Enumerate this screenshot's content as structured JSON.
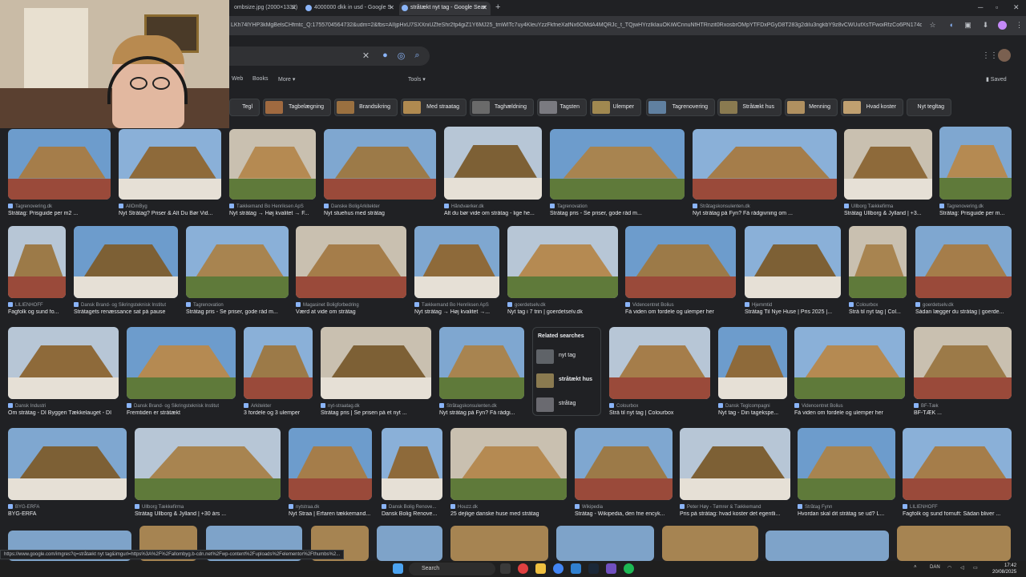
{
  "browser": {
    "tabs": [
      {
        "label": "ombsize.jpg (2000×1332)",
        "active": false
      },
      {
        "label": "4000000 dkk in usd - Google S",
        "active": false
      },
      {
        "label": "stråtækt nyt tag - Google Sear",
        "active": true
      }
    ],
    "url": "LKh74lYHP3kMgBelsCHfmtc_Q:1755704564732&udm=2&fbs=AIIjpHxU7SXXniUZfeShr2fp4giZ1Y6MJ25_tmWITc7uy4KleuYzzFkfneXafNx6OMdA4MQRJc_t_TQjwHYrzlkIauOKiWCnnuNfHTRnzit0RxosbrOMpYTFDxPGyD8T283g2diIu3ngkbY9z8vCWUufXsTFwoiRfzCo6PN174qxySRWv...",
    "status_url": "https://www.google.com/imgres?q=stråtækt nyt tag&imgurl=https%3A%2F%2Fallombyg.b-cdn.net%2Fwp-content%2Fuploads%2Felementor%2Fthumbs%2...",
    "new_tab_icon": "plus-icon",
    "profile_icon": "avatar-icon"
  },
  "google": {
    "nav": [
      "Web",
      "Books",
      "More",
      "Tools"
    ],
    "saved_label": "Saved",
    "chips": [
      {
        "label": "Tegl",
        "color": "#8b3a2a"
      },
      {
        "label": "Tagbelægning",
        "color": "#a06a40"
      },
      {
        "label": "Brandsikring",
        "color": "#9a7040"
      },
      {
        "label": "Med straatag",
        "color": "#b08a50"
      },
      {
        "label": "Taghældning",
        "color": "#6a6a6a"
      },
      {
        "label": "Tagsten",
        "color": "#7a7a80"
      },
      {
        "label": "Ulemper",
        "color": "#a08850"
      },
      {
        "label": "Tagrenovering",
        "color": "#6080a0"
      },
      {
        "label": "Stråtækt hus",
        "color": "#8a7a50"
      },
      {
        "label": "Menning",
        "color": "#b09060"
      },
      {
        "label": "Hvad koster",
        "color": "#c0a070"
      },
      {
        "label": "Nyt tegltag",
        "color": ""
      }
    ],
    "results": [
      {
        "src": "Tagrenovering.dk",
        "title": "Stråtag: Prisguide per m2 ..."
      },
      {
        "src": "AllOmByg",
        "title": "Nyt Stråtag? Priser & Alt Du Bør Vid..."
      },
      {
        "src": "Tækkemand Bo Henriksen ApS",
        "title": "Nyt stråtag → Høj kvalitet → F..."
      },
      {
        "src": "Danske BoligArkitekter",
        "title": "Nyt stuehus med stråtag"
      },
      {
        "src": "Håndværker.dk",
        "title": "Alt du bør vide om stråtag - lige he..."
      },
      {
        "src": "Tagrenovation",
        "title": "Stråtag pris - Se priser, gode råd m..."
      },
      {
        "src": "Stråtagskonsulenten.dk",
        "title": "Nyt stråtag på Fyn? Få rådgivning om ..."
      },
      {
        "src": "Ullborg Tækkefirma",
        "title": "Stråtag Ullborg & Jylland | +3..."
      },
      {
        "src": "Tagrenovering.dk",
        "title": "Stråtag: Prisguide per m..."
      },
      {
        "src": "LILIENHOFF",
        "title": "Fagfolk og sund fo..."
      },
      {
        "src": "Dansk Brand- og Sikringsteknisk Institut",
        "title": "Stråtagets renæssance sat på pause"
      },
      {
        "src": "Tagrenovation",
        "title": "Stråtag pris - Se priser, gode råd m..."
      },
      {
        "src": "Magasinet Boligforbedring",
        "title": "Værd at vide om stråtag"
      },
      {
        "src": "Tækkemand Bo Henriksen ApS",
        "title": "Nyt stråtag → Høj kvalitet →..."
      },
      {
        "src": "goerdetselv.dk",
        "title": "Nyt tag i 7 trin | goerdetselv.dk"
      },
      {
        "src": "Videncentret Bolius",
        "title": "Få viden om fordele og ulemper her"
      },
      {
        "src": "Hjemmtid",
        "title": "Stråtag Til Nye Huse | Pris 2025 |..."
      },
      {
        "src": "Colourbox",
        "title": "Strå til nyt tag | Col..."
      },
      {
        "src": "goerdetselv.dk",
        "title": "Sådan lægger du stråtag | goerde..."
      },
      {
        "src": "Dansk Industri",
        "title": "Om stråtag - DI Byggeri Tækkelauget - DI"
      },
      {
        "src": "Dansk Brand- og Sikringsteknisk Institut",
        "title": "Fremtiden er stråtækt"
      },
      {
        "src": "Arkitekter",
        "title": "3 fordele og 3 ulemper"
      },
      {
        "src": "nyt-straatag.dk",
        "title": "Stråtag pris | Se prisen på et nyt ..."
      },
      {
        "src": "Stråtagskonsulenten.dk",
        "title": "Nyt stråtag på Fyn? Få rådgi..."
      },
      {
        "src": "Colourbox",
        "title": "Strå til nyt tag | Colourbox"
      },
      {
        "src": "Dansk Teglcompagni",
        "title": "Nyt tag - Din tagekspe..."
      },
      {
        "src": "Videncentret Bolius",
        "title": "Få viden om fordele og ulemper her"
      },
      {
        "src": "BF-Tæk",
        "title": "BF-TÆK ..."
      },
      {
        "src": "BYG-ERFA",
        "title": "BYG-ERFA"
      },
      {
        "src": "Ullborg Tækkefirma",
        "title": "Stråtag Ullborg & Jylland | +30 års ..."
      },
      {
        "src": "nytstraa.dk",
        "title": "Nyt Straa | Erfaren tækkemand..."
      },
      {
        "src": "Dansk Bolig Renove...",
        "title": "Dansk Bolig Renove..."
      },
      {
        "src": "Houzz.dk",
        "title": "25 dejlige danske huse med stråtag"
      },
      {
        "src": "Wikipedia",
        "title": "Stråtag - Wikipedia, den frie encyk..."
      },
      {
        "src": "Peter Høy - Tømrer & Tækkemand",
        "title": "Pris på stråtag: hvad koster det egentli..."
      },
      {
        "src": "Stråtag Fynn",
        "title": "Hvordan skal dit stråtag se ud? L..."
      },
      {
        "src": "LILIENHOFF",
        "title": "Fagfolk og sund fornuft: Sådan bliver ..."
      }
    ],
    "related": {
      "heading": "Related searches",
      "items": [
        "nyt tag",
        "stråtækt hus",
        "stråtag"
      ]
    }
  },
  "taskbar": {
    "search_label": "Search",
    "lang": "DAN",
    "time": "17:42",
    "date": "20/08/2025"
  }
}
